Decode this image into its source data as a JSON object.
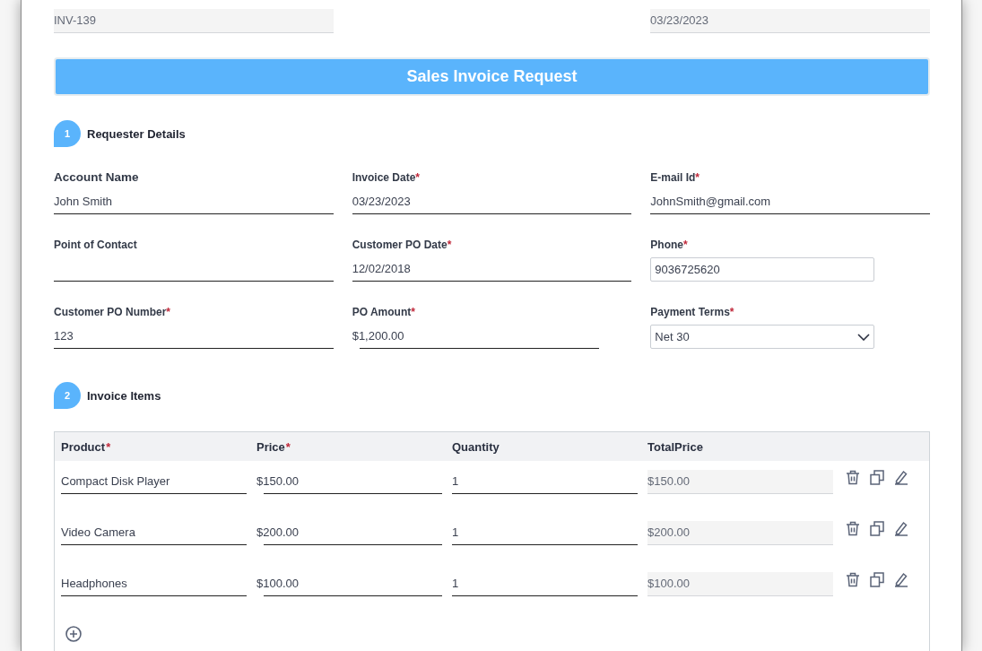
{
  "header_fields": [
    {
      "kind": "readonly",
      "value": "INV-139"
    },
    {
      "kind": "readonly",
      "value": "03/23/2023"
    }
  ],
  "banner": {
    "title": "Sales Invoice Request"
  },
  "sections": [
    {
      "number": "1",
      "title": "Requester Details",
      "fields": [
        {
          "label": "Account Name",
          "large_label": true,
          "kind": "underline",
          "value": "John Smith"
        },
        {
          "label": "Invoice Date",
          "required_mark": "*",
          "large_label": false,
          "kind": "underline",
          "value": "03/23/2023"
        },
        {
          "label": "E-mail Id",
          "required_mark": "*",
          "large_label": false,
          "kind": "underline",
          "value": "JohnSmith@gmail.com"
        },
        {
          "label": "Point of Contact",
          "large_label": false,
          "kind": "underline"
        },
        {
          "label": "Customer PO Date",
          "required_mark": "*",
          "large_label": false,
          "kind": "underline",
          "value": "12/02/2018"
        },
        {
          "label": "Phone",
          "required_mark": "*",
          "large_label": false,
          "kind": "box",
          "value": "9036725620"
        },
        {
          "label": "Customer PO Number",
          "required_mark": "*",
          "large_label": false,
          "kind": "underline",
          "value": "123"
        },
        {
          "label": "PO Amount",
          "required_mark": "*",
          "large_label": false,
          "kind": "currency",
          "value": "$1,200.00"
        },
        {
          "label": "Payment Terms",
          "required_mark": "*",
          "large_label": false,
          "kind": "select",
          "value": "Net 30"
        }
      ]
    },
    {
      "number": "2",
      "title": "Invoice Items",
      "table": {
        "columns": [
          {
            "label": "Product",
            "required_mark": "*",
            "kind": "underline"
          },
          {
            "label": "Price",
            "required_mark": "*",
            "kind": "currency"
          },
          {
            "label": "Quantity",
            "kind": "underline"
          },
          {
            "label": "TotalPrice",
            "kind": "readonly"
          }
        ],
        "rows": [
          {
            "cells": [
              "Compact Disk Player",
              "$150.00",
              "1",
              "$150.00"
            ]
          },
          {
            "cells": [
              "Video Camera",
              "$200.00",
              "1",
              "$200.00"
            ]
          },
          {
            "cells": [
              "Headphones",
              "$100.00",
              "1",
              "$100.00"
            ]
          }
        ]
      }
    }
  ]
}
